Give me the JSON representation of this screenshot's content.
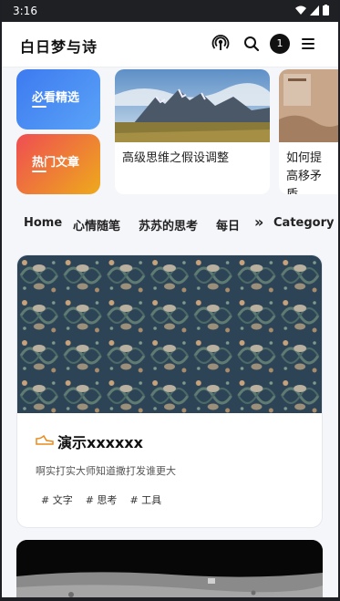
{
  "status": {
    "time": "3:16"
  },
  "app": {
    "title": "白日梦与诗",
    "notification_count": "1"
  },
  "featured": {
    "pills": [
      {
        "label": "必看精选"
      },
      {
        "label": "热门文章"
      }
    ],
    "cards": [
      {
        "title": "高级思维之假设调整"
      },
      {
        "title": "如何提高移矛盾"
      }
    ]
  },
  "nav": {
    "items": [
      "Home",
      "心情随笔",
      "苏苏的思考",
      "每日"
    ],
    "more": "»",
    "category": "Category"
  },
  "posts": [
    {
      "title": "演示xxxxxx",
      "description": "啊实打实大师知道撒打发谁更大",
      "tags": [
        "# 文字",
        "# 思考",
        "# 工具"
      ]
    }
  ],
  "colors": {
    "pill_blue": "#3d7af0",
    "pill_orange": "#eeaa1c",
    "pill_red": "#ef4d52",
    "post_icon": "#e88a1a"
  }
}
